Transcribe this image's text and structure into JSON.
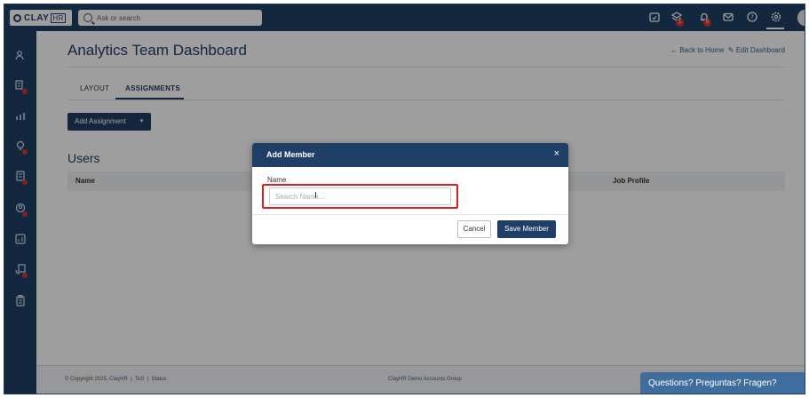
{
  "topbar": {
    "logo_text": "CLAY",
    "logo_suffix": "HR",
    "search_placeholder": "Ask or search",
    "icons": [
      "calendar-check-icon",
      "layers-icon",
      "bell-icon",
      "mail-icon",
      "help-icon",
      "settings-icon",
      "avatar"
    ],
    "layers_badge": "1",
    "bell_badge": "5"
  },
  "sidebar": {
    "items": [
      "users-icon",
      "org-chart-icon",
      "analytics-icon",
      "lightbulb-icon",
      "document-icon",
      "badge-icon",
      "report-icon",
      "handshake-icon",
      "clipboard-icon"
    ]
  },
  "page": {
    "title": "Analytics Team Dashboard",
    "back_link": "← Back to Home",
    "edit_link": "Edit Dashboard",
    "tabs": [
      {
        "label": "LAYOUT",
        "active": false
      },
      {
        "label": "ASSIGNMENTS",
        "active": true
      }
    ],
    "add_button": "Add Assignment",
    "users_title": "Users",
    "table_headers": [
      "Name",
      "Job Profile"
    ]
  },
  "footer": {
    "copyright": "© Copyright 2025,",
    "company_link": "ClayHR",
    "sep": "|",
    "tos": "ToS",
    "status": "Status",
    "center": "ClayHR Demo Accounts Group"
  },
  "chat": {
    "label": "Questions? Preguntas? Fragen?"
  },
  "modal": {
    "title": "Add Member",
    "close": "×",
    "field_label": "Name",
    "input_placeholder": "Search Name...",
    "input_value": "",
    "cancel_label": "Cancel",
    "save_label": "Save Member"
  },
  "colors": {
    "primary": "#203f66",
    "highlight": "#e21d1d",
    "badge": "#d9342b",
    "chat": "#3f6e9e"
  }
}
